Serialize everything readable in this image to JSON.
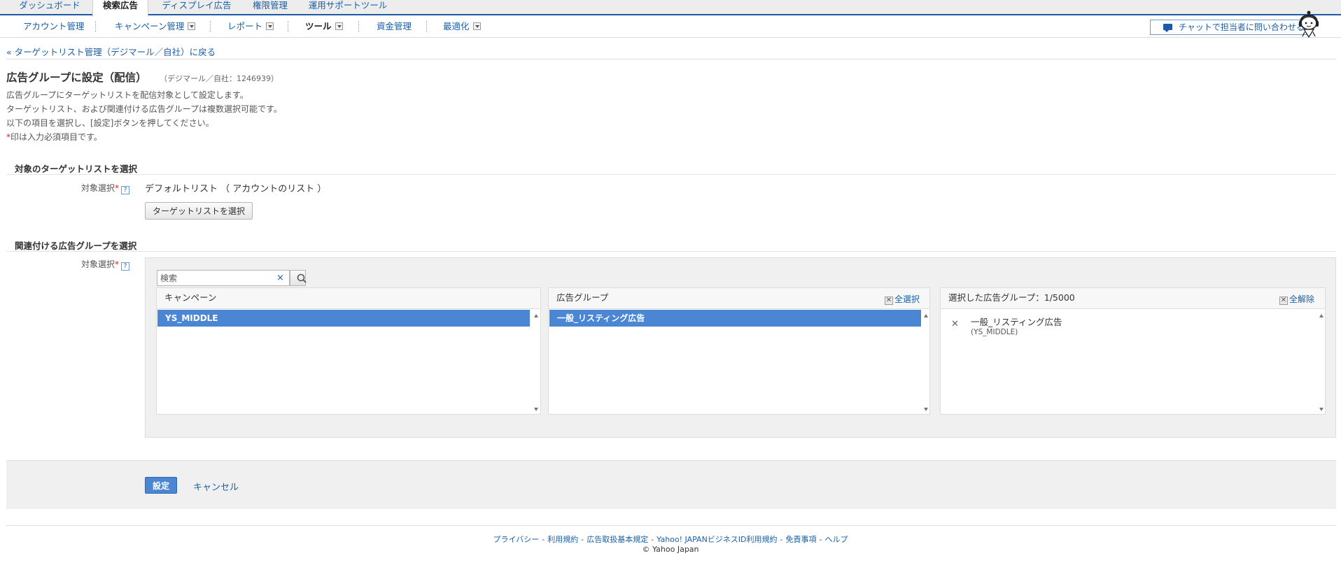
{
  "top_tabs": [
    {
      "label": "ダッシュボード",
      "active": false
    },
    {
      "label": "検索広告",
      "active": true
    },
    {
      "label": "ディスプレイ広告",
      "active": false
    },
    {
      "label": "権限管理",
      "active": false
    },
    {
      "label": "運用サポートツール",
      "active": false
    }
  ],
  "sub_nav": {
    "items": [
      {
        "label": "アカウント管理"
      },
      {
        "label": "キャンペーン管理"
      },
      {
        "label": "レポート"
      },
      {
        "label": "ツール"
      },
      {
        "label": "資金管理"
      },
      {
        "label": "最適化"
      }
    ],
    "chat_label": "チャットで担当者に問い合わせる"
  },
  "back_link": "« ターゲットリスト管理（デジマール／自社）に戻る",
  "header": {
    "title": "広告グループに設定（配信）",
    "account_note": "（デジマール／自社：1246939）",
    "desc_lines": [
      "広告グループにターゲットリストを配信対象として設定します。",
      "ターゲットリスト、および関連付ける広告グループは複数選択可能です。",
      "以下の項目を選択し、[設定]ボタンを押してください。"
    ],
    "required_mark": "*",
    "required_text": "印は入力必須項目です。"
  },
  "section_target": {
    "title": "対象のターゲットリストを選択",
    "field_label": "対象選択",
    "required_mark": "*",
    "help": "?",
    "value": "デフォルトリスト （ アカウントのリスト ）",
    "button_label": "ターゲットリストを選択"
  },
  "section_adgroup": {
    "title": "関連付ける広告グループを選択",
    "field_label": "対象選択",
    "required_mark": "*",
    "help": "?"
  },
  "picker": {
    "search_placeholder": "検索",
    "clear_symbol": "×",
    "campaign_col": {
      "header": "キャンペーン",
      "selected_item": "YS_MIDDLE"
    },
    "adgroup_col": {
      "header": "広告グループ",
      "action_label": "全選択",
      "selected_item": "一般_リスティング広告"
    },
    "chosen_col": {
      "header": "選択した広告グループ：1/5000",
      "action_label": "全解除",
      "items": [
        {
          "name": "一般_リスティング広告",
          "campaign": "(YS_MIDDLE)"
        }
      ]
    }
  },
  "actions": {
    "submit_label": "設定",
    "cancel_label": "キャンセル"
  },
  "footer": {
    "links": [
      "プライバシー",
      "利用規約",
      "広告取扱基本規定",
      "Yahoo! JAPANビジネスID利用規約",
      "免責事項",
      "ヘルプ"
    ],
    "separator": "-",
    "copyright": "© Yahoo Japan"
  },
  "colors": {
    "brand_blue": "#1e5aa7",
    "link_blue": "#1a5fa8",
    "selection_blue": "#4a86d4",
    "required_red": "#e02020"
  }
}
